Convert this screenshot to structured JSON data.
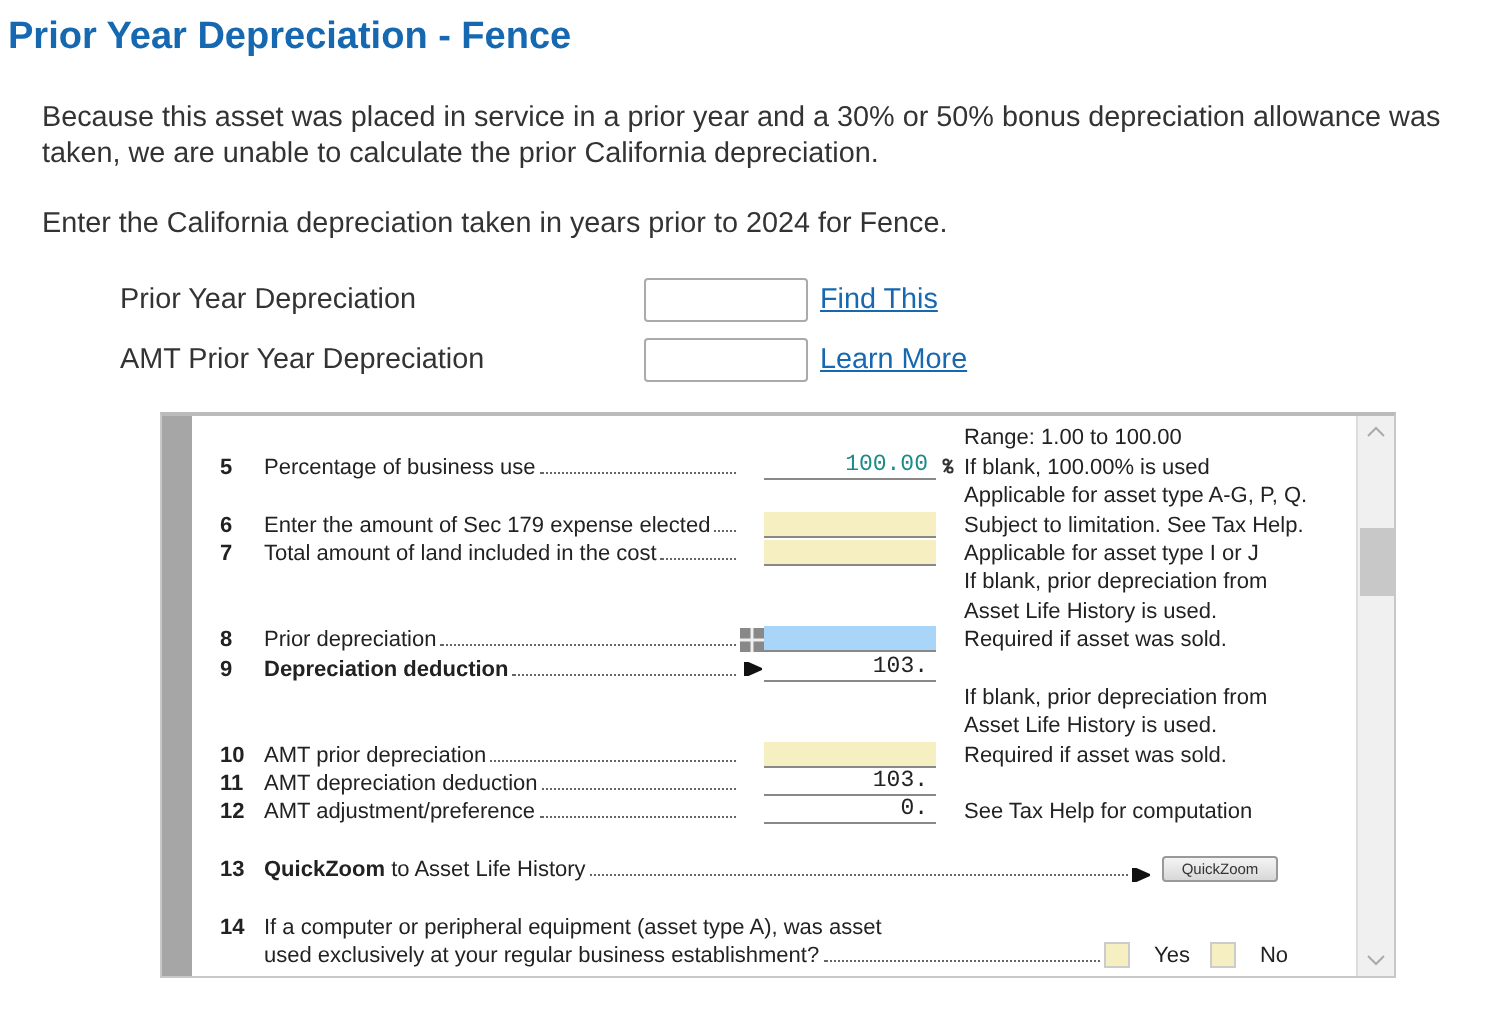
{
  "title": "Prior Year Depreciation - Fence",
  "intro": "Because this asset was placed in service in a prior year and a 30% or 50% bonus depreciation allowance was taken, we are unable to calculate the prior California depreciation.",
  "prompt": "Enter the California depreciation taken in years prior to 2024 for Fence.",
  "fields": [
    {
      "label": "Prior Year Depreciation",
      "link": "Find This"
    },
    {
      "label": "AMT Prior Year Depreciation",
      "link": "Learn More"
    }
  ],
  "form_lines": [
    {
      "kind": "note",
      "note": "Range: 1.00 to 100.00"
    },
    {
      "kind": "field",
      "num": "5",
      "label": "Percentage of business use",
      "entered": true,
      "value": "100.00",
      "flag": true,
      "note": "If blank, 100.00% is used"
    },
    {
      "kind": "note",
      "note": "Applicable for asset type A-G, P, Q."
    },
    {
      "kind": "field",
      "num": "6",
      "label": "Enter the amount of Sec 179 expense elected",
      "color": "#f5efc2",
      "note": "Subject to limitation. See Tax Help."
    },
    {
      "kind": "field",
      "num": "7",
      "label": "Total amount of land included in the cost",
      "color": "#f5efc2",
      "note": "Applicable for asset type I or J"
    },
    {
      "kind": "note",
      "note": "If blank, prior depreciation from"
    },
    {
      "kind": "note",
      "note": "Asset Life History is used."
    },
    {
      "kind": "field",
      "num": "8",
      "label": "Prior depreciation",
      "color": "#a9d5f9",
      "grid_icon": true,
      "note": "Required if asset was sold."
    },
    {
      "kind": "field",
      "num": "9",
      "label": "Depreciation deduction",
      "bold": true,
      "value": "103.",
      "arrow": true
    },
    {
      "kind": "note",
      "note": "If blank, prior depreciation from"
    },
    {
      "kind": "note",
      "note": "Asset Life History is used."
    },
    {
      "kind": "field",
      "num": "10",
      "label": "AMT prior depreciation",
      "color": "#f5efc2",
      "note": "Required if asset was sold."
    },
    {
      "kind": "field",
      "num": "11",
      "label": "AMT depreciation deduction",
      "value": "103."
    },
    {
      "kind": "field",
      "num": "12",
      "label": "AMT adjustment/preference",
      "value": "0.",
      "note": "See Tax Help for computation"
    },
    {
      "kind": "note"
    },
    {
      "kind": "quickzoom",
      "num": "13",
      "label": "**QuickZoom** to Asset Life History",
      "button": "QuickZoom"
    },
    {
      "kind": "note"
    },
    {
      "kind": "text",
      "num": "14",
      "label": "If a computer or peripheral equipment (asset type A), was asset"
    },
    {
      "kind": "yesno",
      "label": "used exclusively at your regular business establishment?",
      "options": [
        {
          "label": "Yes",
          "checked": false
        },
        {
          "label": "No",
          "checked": false
        }
      ]
    }
  ]
}
